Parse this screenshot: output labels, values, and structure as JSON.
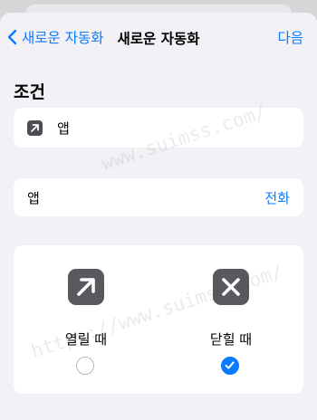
{
  "nav": {
    "back_label": "새로운 자동화",
    "title": "새로운 자동화",
    "next_label": "다음"
  },
  "section": {
    "title": "조건"
  },
  "app_card": {
    "label": "앱",
    "icon": "open-app-arrow-icon"
  },
  "app_row": {
    "label": "앱",
    "value": "전화"
  },
  "options": [
    {
      "label": "열릴 때",
      "icon": "open-arrow-icon",
      "selected": false
    },
    {
      "label": "닫힐 때",
      "icon": "close-x-icon",
      "selected": true
    }
  ],
  "watermark": {
    "text1": "www.suimss.com/",
    "text2": "https://www.suimss.com/"
  },
  "colors": {
    "accent": "#0a7aff",
    "background": "#f2f2f6",
    "icon_fill": "#58585d"
  }
}
